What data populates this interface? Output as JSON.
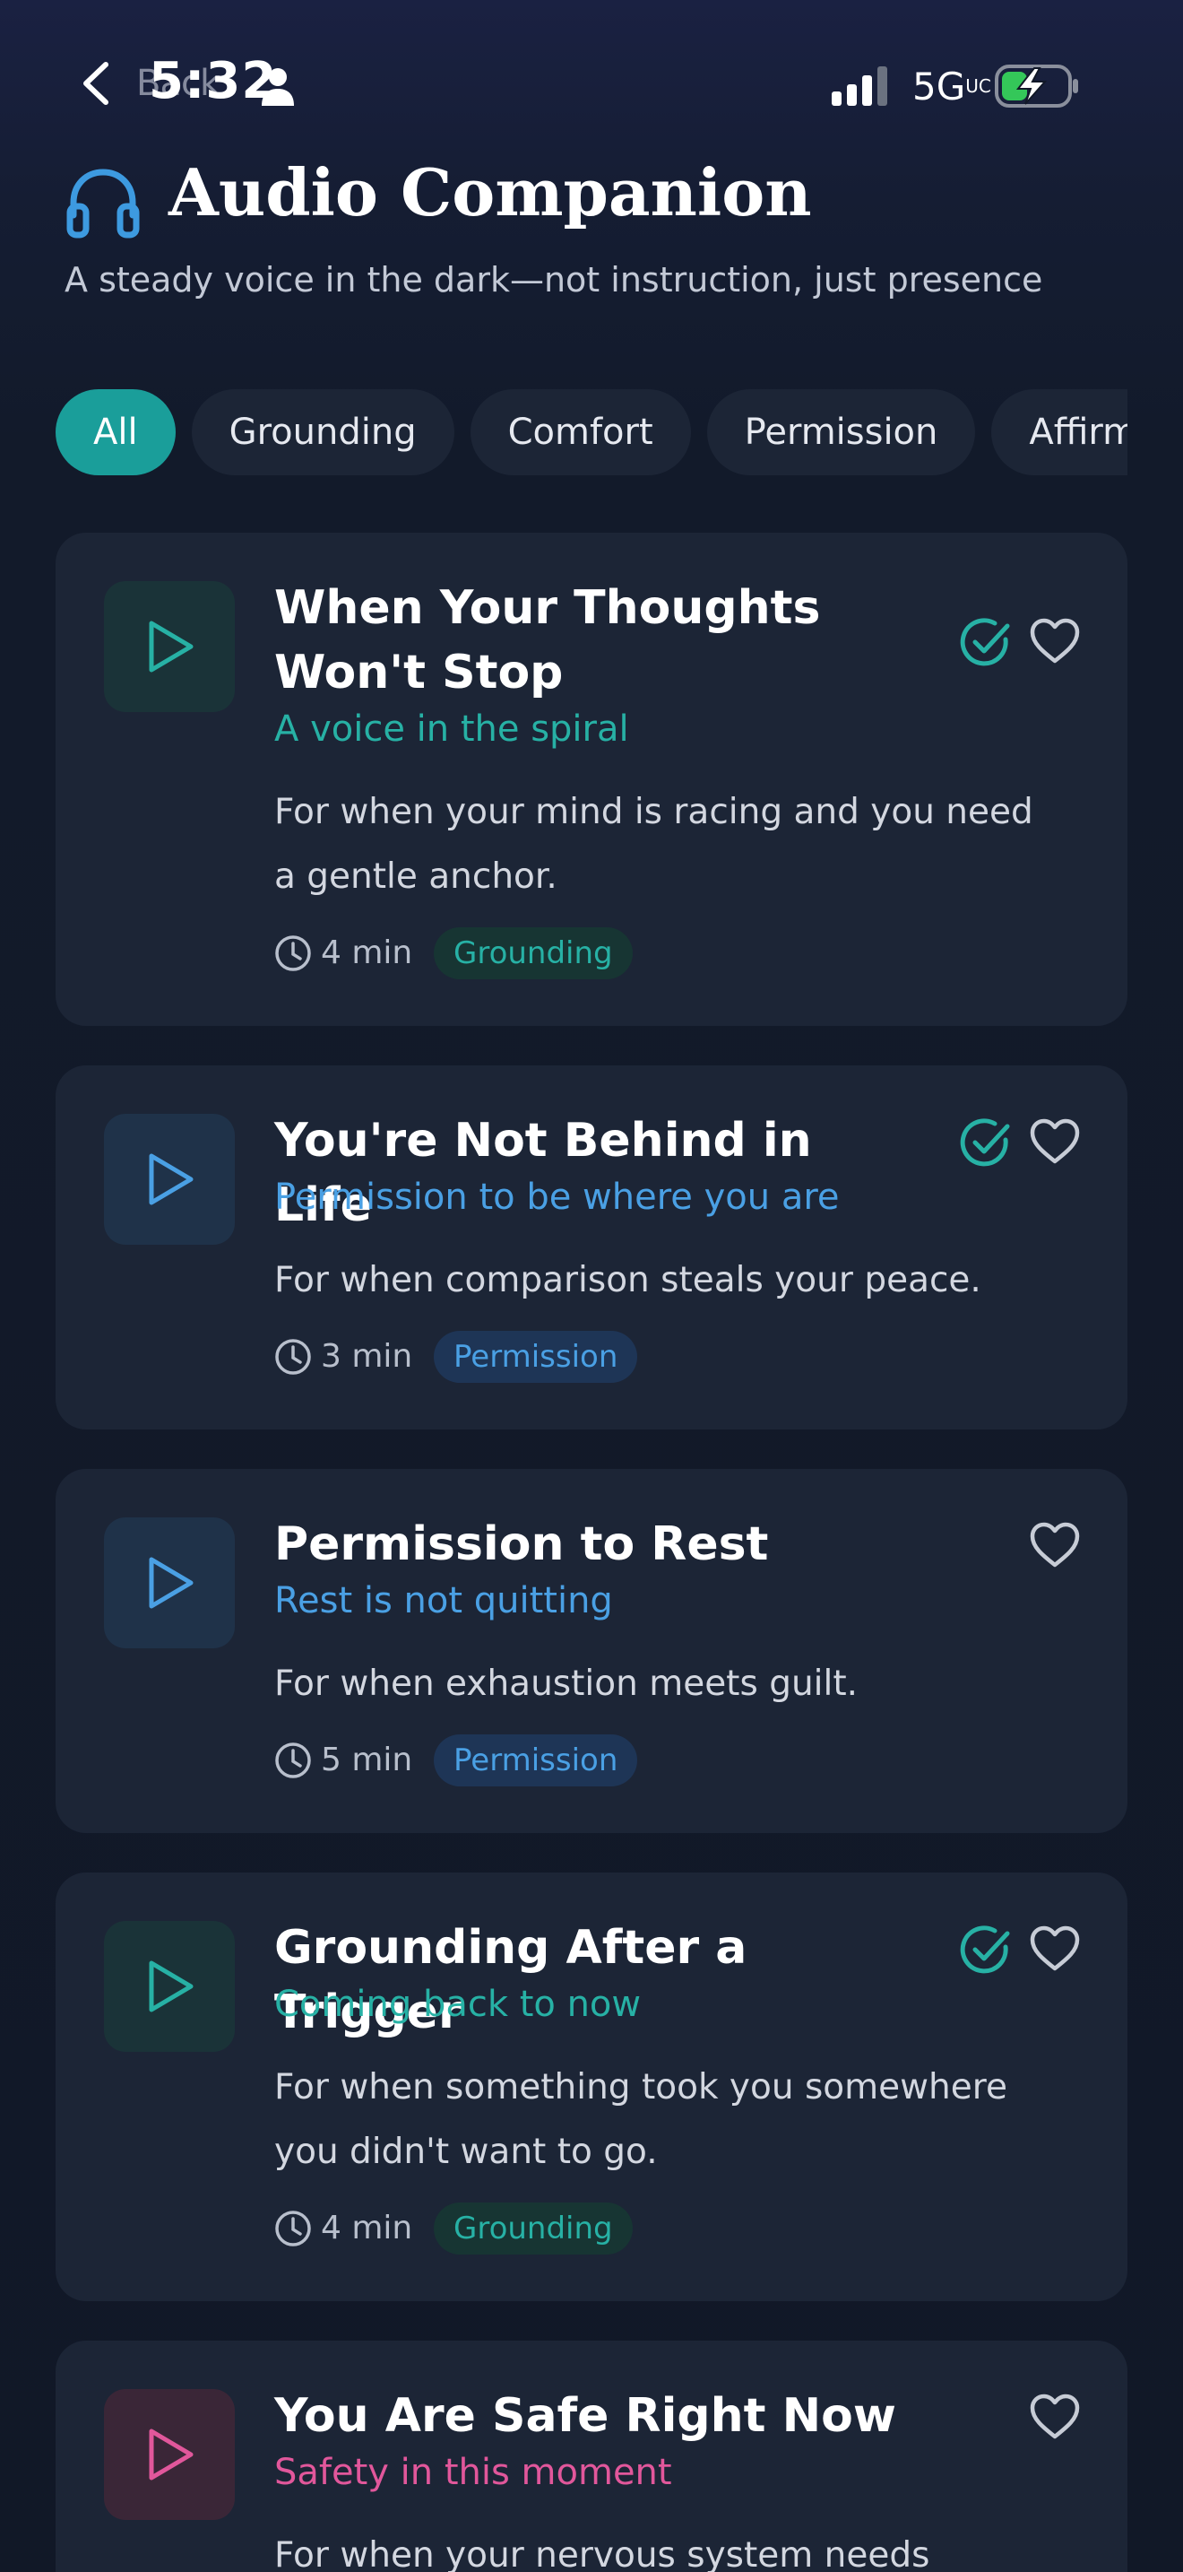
{
  "status_bar": {
    "back_label": "Back",
    "time": "5:32",
    "network": "5G",
    "network_suffix": "UC"
  },
  "header": {
    "title": "Audio Companion",
    "subtitle": "A steady voice in the dark—not instruction, just presence",
    "icon": "headphones-icon"
  },
  "filters": [
    {
      "label": "All",
      "active": true
    },
    {
      "label": "Grounding",
      "active": false
    },
    {
      "label": "Comfort",
      "active": false
    },
    {
      "label": "Permission",
      "active": false
    },
    {
      "label": "Affirmations",
      "active": false
    }
  ],
  "tracks": [
    {
      "title": "When Your Thoughts Won't Stop",
      "subtitle": "A voice in the spiral",
      "description": "For when your mind is racing and you need a gentle anchor.",
      "duration": "4 min",
      "tag": "Grounding",
      "completed": true,
      "accent": "#27b1a5"
    },
    {
      "title": "You're Not Behind in Life",
      "subtitle": "Permission to be where you are",
      "description": "For when comparison steals your peace.",
      "duration": "3 min",
      "tag": "Permission",
      "completed": true,
      "accent": "#4aa0e4"
    },
    {
      "title": "Permission to Rest",
      "subtitle": "Rest is not quitting",
      "description": "For when exhaustion meets guilt.",
      "duration": "5 min",
      "tag": "Permission",
      "completed": false,
      "accent": "#4aa0e4"
    },
    {
      "title": "Grounding After a Trigger",
      "subtitle": "Coming back to now",
      "description": "For when something took you somewhere you didn't want to go.",
      "duration": "4 min",
      "tag": "Grounding",
      "completed": true,
      "accent": "#27b1a5"
    },
    {
      "title": "You Are Safe Right Now",
      "subtitle": "Safety in this moment",
      "description": "For when your nervous system needs",
      "completed": false,
      "accent": "#e1579b"
    }
  ],
  "colors": {
    "teal": "#27b1a5",
    "blue": "#4aa0e4",
    "pink": "#e1579b",
    "active_chip": "#1a9e9a",
    "card": "#1c2536"
  }
}
